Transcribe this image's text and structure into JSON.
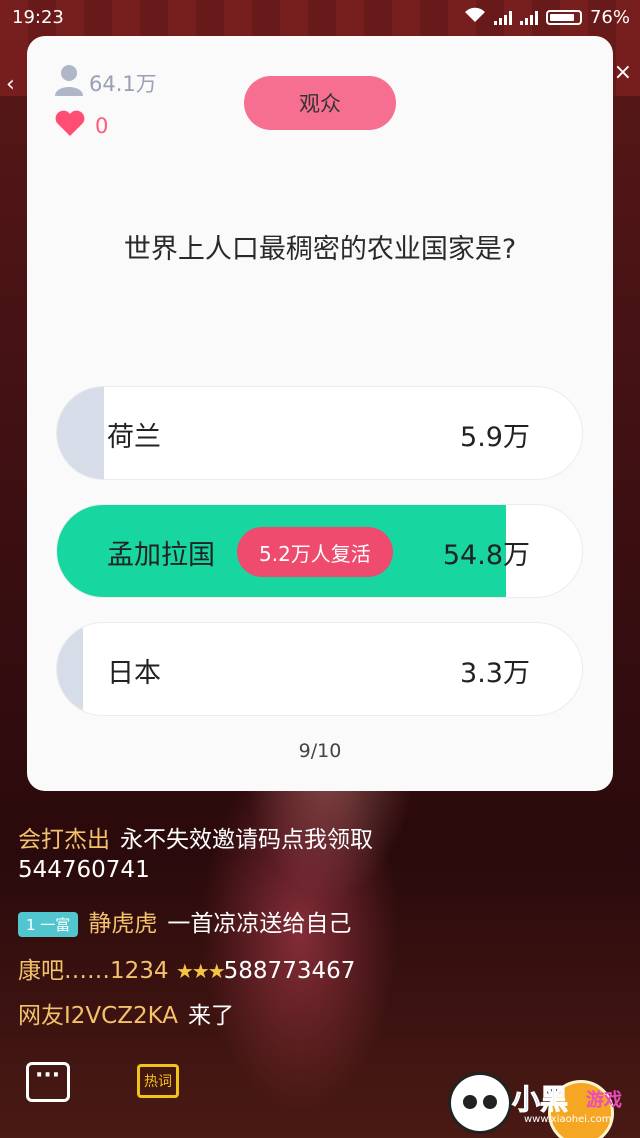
{
  "status_bar": {
    "time": "19:23",
    "battery": "76%"
  },
  "card": {
    "viewers": "64.1万",
    "likes": "0",
    "role_label": "观众",
    "question": "世界上人口最稠密的农业国家是?",
    "options": [
      {
        "label": "荷兰",
        "count": "5.9万",
        "fill_fraction": 0.09,
        "correct": false
      },
      {
        "label": "孟加拉国",
        "count": "54.8万",
        "fill_fraction": 0.855,
        "correct": true,
        "badge": "5.2万人复活"
      },
      {
        "label": "日本",
        "count": "3.3万",
        "fill_fraction": 0.05,
        "correct": false
      }
    ],
    "progress": "9/10"
  },
  "chat": [
    {
      "user": "会打杰出",
      "text": "永不失效邀请码点我领取"
    },
    {
      "text": "544760741"
    },
    {
      "badge": "1 一富",
      "user": "静虎虎",
      "text": "一首凉凉送给自己"
    },
    {
      "user": "康吧……1234",
      "stars": "★★★",
      "text": "588773467"
    },
    {
      "user": "网友I2VCZ2KA",
      "text": "来了"
    }
  ],
  "bottom": {
    "hot_label": "热词"
  },
  "watermark": {
    "brand": "小黑",
    "brand2": "游戏",
    "url": "www.xiaohei.com"
  },
  "colors": {
    "accent_pink": "#f76f90",
    "correct_green": "#17d6a0",
    "revive_red": "#ee4b6e"
  }
}
